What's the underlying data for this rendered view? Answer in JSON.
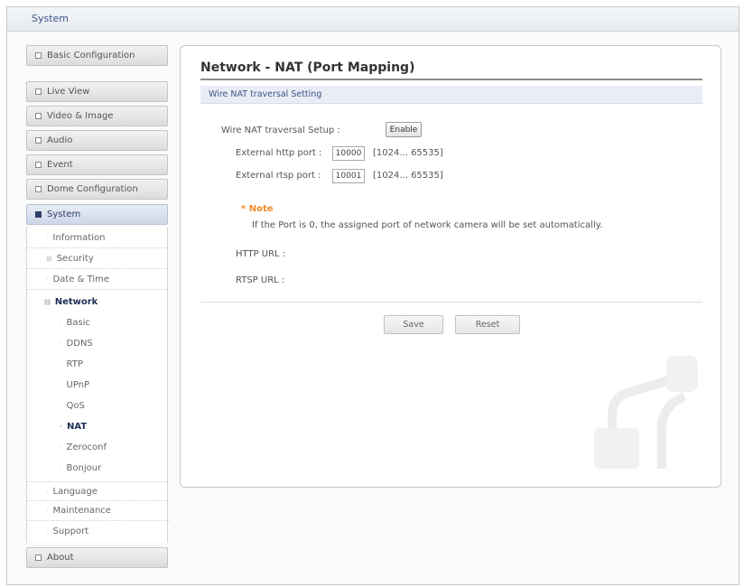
{
  "header": {
    "title": "System"
  },
  "sidebar": {
    "main_items": [
      {
        "label": "Basic Configuration"
      },
      {
        "label": "Live View"
      },
      {
        "label": "Video & Image"
      },
      {
        "label": "Audio"
      },
      {
        "label": "Event"
      },
      {
        "label": "Dome Configuration"
      },
      {
        "label": "System"
      }
    ],
    "system_items": [
      {
        "label": "Information"
      },
      {
        "label": "Security"
      },
      {
        "label": "Date & Time"
      },
      {
        "label": "Network"
      }
    ],
    "network_items": [
      {
        "label": "Basic"
      },
      {
        "label": "DDNS"
      },
      {
        "label": "RTP"
      },
      {
        "label": "UPnP"
      },
      {
        "label": "QoS"
      },
      {
        "label": "NAT"
      },
      {
        "label": "Zeroconf"
      },
      {
        "label": "Bonjour"
      }
    ],
    "system_items_after": [
      {
        "label": "Language"
      },
      {
        "label": "Maintenance"
      },
      {
        "label": "Support"
      }
    ],
    "about": {
      "label": "About"
    }
  },
  "main": {
    "title": "Network - NAT (Port Mapping)",
    "section": "Wire NAT traversal Setting",
    "setup_label": "Wire NAT traversal Setup :",
    "enable_button": "Enable",
    "http_port": {
      "label": "External http port :",
      "value": "10000",
      "range": "[1024... 65535]"
    },
    "rtsp_port": {
      "label": "External rtsp port :",
      "value": "10001",
      "range": "[1024... 65535]"
    },
    "note_title": "* Note",
    "note_text": "If the Port is 0, the assigned port of network camera will be set automatically.",
    "http_url_label": "HTTP URL :",
    "rtsp_url_label": "RTSP URL :",
    "save_button": "Save",
    "reset_button": "Reset"
  },
  "colors": {
    "accent": "#2d3f66",
    "note": "#f08a2c",
    "section_bar": "#e9edf6"
  }
}
